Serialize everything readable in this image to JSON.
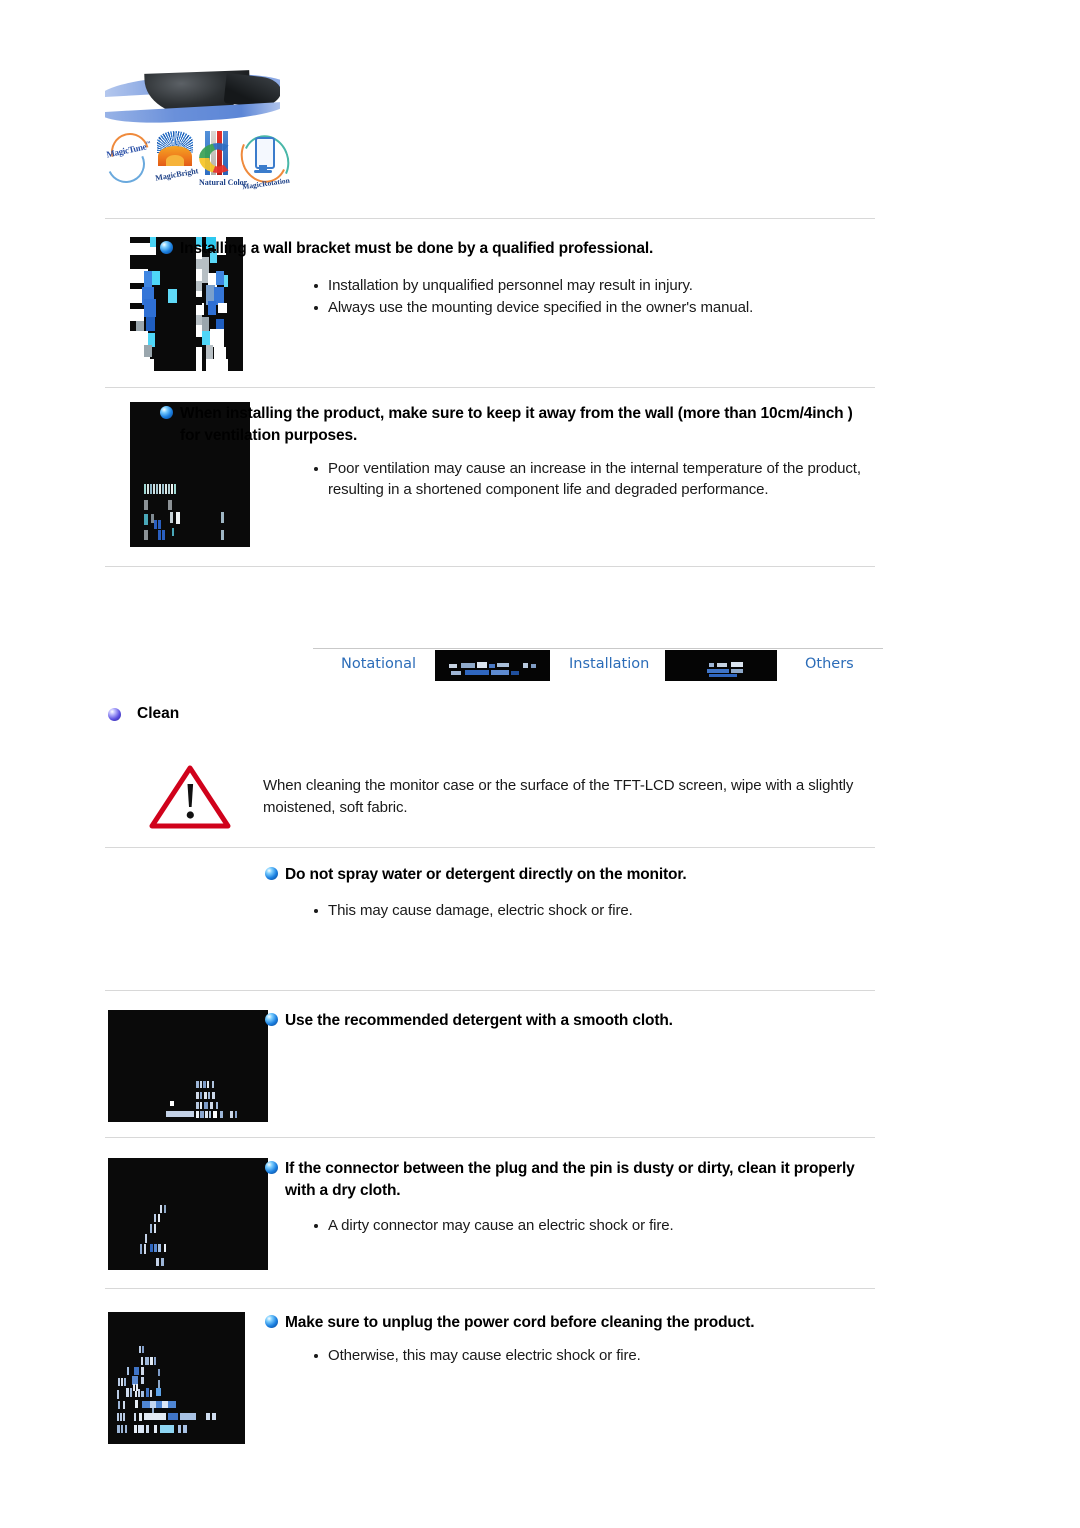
{
  "document": {
    "type": "monitor-user-manual-safety-page",
    "brand": {
      "logos": [
        {
          "name": "MagicTune",
          "text": "MagicTune",
          "tm": "™"
        },
        {
          "name": "MagicBright",
          "text": "MagicBright"
        },
        {
          "name": "Natural Color",
          "text": "Natural Color"
        },
        {
          "name": "MagicRotation",
          "text": "MagicRotation"
        }
      ]
    },
    "sections": [
      {
        "id": "wall-bracket",
        "heading": "Installing a wall bracket must be done by a qualified professional.",
        "bullets": [
          "Installation by unqualified personnel may result in injury.",
          "Always use the mounting device specified in the owner's manual."
        ],
        "thumbnail_alt": "wall-bracket-illustration"
      },
      {
        "id": "ventilation",
        "heading": "When installing the product, make sure to keep it away from the wall (more than 10cm/4inch ) for ventilation purposes.",
        "bullets": [
          "Poor ventilation may cause an increase in the internal temperature of the product, resulting in a shortened component life and degraded performance."
        ],
        "thumbnail_alt": "wall-clearance-illustration"
      }
    ],
    "tabbar": {
      "tabs": [
        {
          "label": "Notational",
          "state": "link"
        },
        {
          "label": "",
          "state": "obscured"
        },
        {
          "label": "Installation",
          "state": "link"
        },
        {
          "label": "",
          "state": "obscured"
        },
        {
          "label": "Others",
          "state": "link"
        }
      ]
    },
    "clean": {
      "title": "Clean",
      "warning_icon": "warning-triangle-icon",
      "note": "When cleaning the monitor case or the surface of the TFT-LCD screen, wipe with a slightly moistened, soft fabric.",
      "items": [
        {
          "id": "no-spray",
          "heading": "Do not spray water or detergent directly on the monitor.",
          "bullets": [
            "This may cause damage, electric shock or fire."
          ],
          "thumbnail_alt": null
        },
        {
          "id": "recommended-detergent",
          "heading": "Use the recommended detergent with a smooth cloth.",
          "bullets": [],
          "thumbnail_alt": "detergent-cloth-illustration"
        },
        {
          "id": "dirty-connector",
          "heading": "If the connector between the plug and the pin is dusty or dirty, clean it properly with a dry cloth.",
          "bullets": [
            "A dirty connector may cause an electric shock or fire."
          ],
          "thumbnail_alt": "plug-pin-illustration"
        },
        {
          "id": "unplug-before-clean",
          "heading": "Make sure to unplug the power cord before cleaning the product.",
          "bullets": [
            "Otherwise, this may cause electric shock or fire."
          ],
          "thumbnail_alt": "unplug-power-cord-illustration"
        }
      ]
    },
    "colors": {
      "link": "#2b6cb8",
      "orb_blue": "#1a7fe0",
      "orb_purple": "#5b4fe0",
      "warning_red": "#d0021b",
      "divider": "#d8d8d8",
      "thumbnail_background": "#0a0a0a"
    }
  }
}
